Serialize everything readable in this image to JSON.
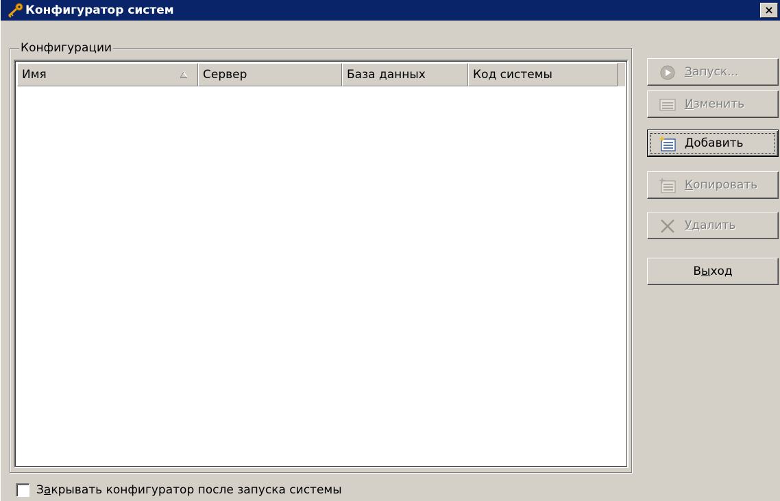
{
  "window": {
    "title": "Конфигуратор систем",
    "close_glyph": "×",
    "icon": "key-icon"
  },
  "group": {
    "label": "Конфигурации"
  },
  "list": {
    "columns": [
      {
        "label": "Имя",
        "sorted": "ascending"
      },
      {
        "label": "Сервер"
      },
      {
        "label": "База данных"
      },
      {
        "label": "Код системы"
      }
    ],
    "rows": []
  },
  "buttons": {
    "run": {
      "label_u": "З",
      "label_rest": "апуск...",
      "enabled": false,
      "icon": "play-circle-icon"
    },
    "edit": {
      "label_u": "И",
      "label_rest": "зменить",
      "enabled": false,
      "icon": "edit-list-icon"
    },
    "add": {
      "label_u": "Д",
      "label_rest": "обавить",
      "enabled": true,
      "icon": "new-list-icon"
    },
    "copy": {
      "label_u": "К",
      "label_rest": "опировать",
      "enabled": false,
      "icon": "copy-list-icon"
    },
    "delete": {
      "label_u": "У",
      "label_rest": "далить",
      "enabled": false,
      "icon": "x-icon"
    },
    "exit": {
      "label_pre": "В",
      "label_u": "ы",
      "label_rest": "ход",
      "enabled": true
    }
  },
  "options": {
    "close_after_launch": {
      "label_pre": "З",
      "label_u": "а",
      "label_rest": "крывать конфигуратор после запуска системы",
      "checked": false
    }
  },
  "colors": {
    "titlebar": "#0a246a",
    "face": "#d4d0c8",
    "disabled_text": "#808080"
  }
}
